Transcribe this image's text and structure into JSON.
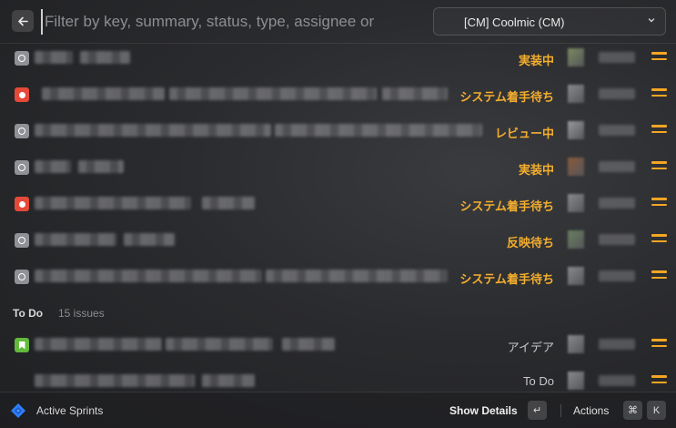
{
  "header": {
    "search_placeholder": "Filter by key, summary, status, type, assignee or",
    "project_label": "[CM] Coolmic (CM)"
  },
  "issues": [
    {
      "type": "task",
      "status": "実装中",
      "status_style": "accent",
      "avatar_color": "#7a8a60"
    },
    {
      "type": "bug",
      "status": "システム着手待ち",
      "status_style": "accent",
      "avatar_color": "#8a8a8e"
    },
    {
      "type": "task",
      "status": "レビュー中",
      "status_style": "accent",
      "avatar_color": "#9a9a9e"
    },
    {
      "type": "task",
      "status": "実装中",
      "status_style": "accent",
      "avatar_color": "#8a5a3a"
    },
    {
      "type": "bug",
      "status": "システム着手待ち",
      "status_style": "accent",
      "avatar_color": "#8a8a8e"
    },
    {
      "type": "task",
      "status": "反映待ち",
      "status_style": "accent",
      "avatar_color": "#6a8060"
    },
    {
      "type": "task",
      "status": "システム着手待ち",
      "status_style": "accent",
      "avatar_color": "#8a8a8e"
    }
  ],
  "section": {
    "title": "To Do",
    "count": "15 issues"
  },
  "todo_issues": [
    {
      "type": "story",
      "status": "アイデア",
      "status_style": "neutral",
      "avatar_color": "#8a8a8e"
    },
    {
      "type": "none",
      "status": "To Do",
      "status_style": "neutral",
      "avatar_color": "#8a8a8e"
    }
  ],
  "footer": {
    "title": "Active Sprints",
    "show_details": "Show Details",
    "enter_key": "↵",
    "actions": "Actions",
    "cmd_key": "⌘",
    "k_key": "K"
  },
  "colors": {
    "accent": "#f4ae2e",
    "bug": "#e5493a",
    "story": "#63ba3c",
    "task": "#8f9196"
  },
  "icons": {
    "back": "arrow-left-icon",
    "chevron": "chevron-down-icon",
    "priority": "priority-medium-icon",
    "brand": "jira-icon"
  }
}
